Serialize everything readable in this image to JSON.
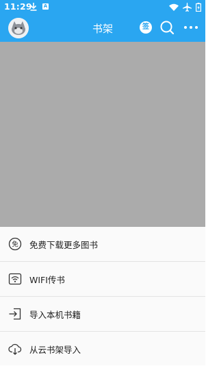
{
  "status_bar": {
    "time": "11:29",
    "icons": [
      "download-icon",
      "a-notification-icon",
      "wifi-icon",
      "airplane-icon",
      "battery-icon"
    ],
    "a_glyph": "A"
  },
  "toolbar": {
    "title": "书架",
    "sign_label": "签",
    "icons": [
      "avatar",
      "sign-in-icon",
      "search-icon",
      "more-icon"
    ],
    "accent_color": "#2aa6f1"
  },
  "sheet": {
    "items": [
      {
        "label": "免费下载更多图书",
        "icon": "free-download-icon",
        "icon_glyph": "免"
      },
      {
        "label": "WIFI传书",
        "icon": "wifi-transfer-icon"
      },
      {
        "label": "导入本机书籍",
        "icon": "import-local-icon"
      },
      {
        "label": "从云书架导入",
        "icon": "cloud-import-icon"
      }
    ]
  }
}
